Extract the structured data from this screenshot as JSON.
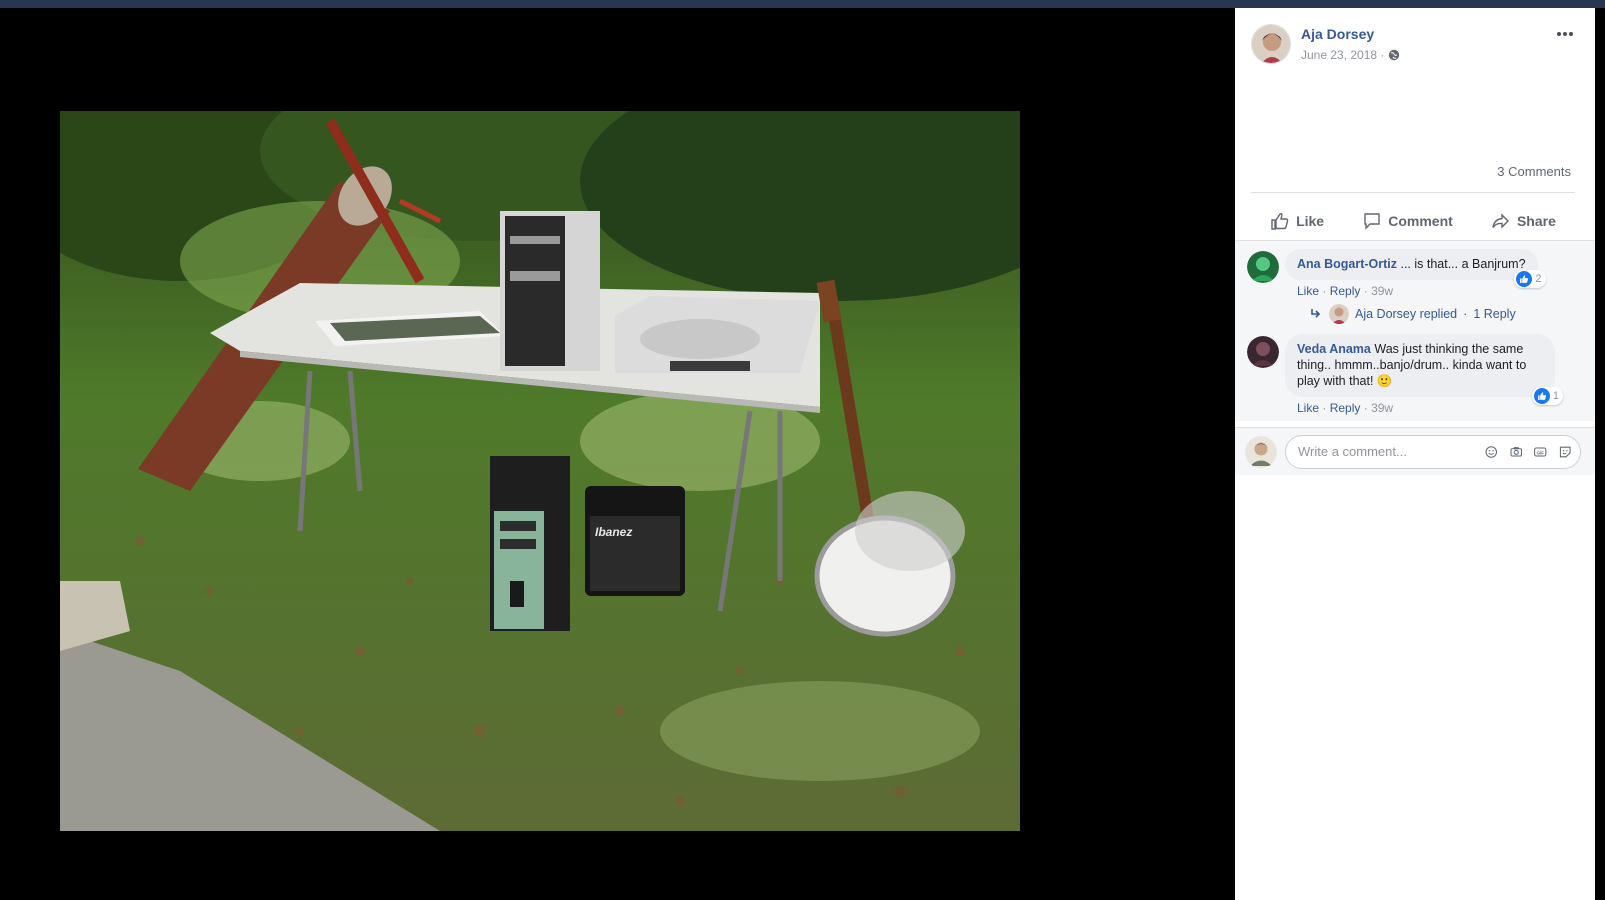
{
  "post": {
    "author": "Aja Dorsey",
    "date": "June 23, 2018 ·",
    "comment_count": "3 Comments"
  },
  "actions": {
    "like": "Like",
    "comment": "Comment",
    "share": "Share"
  },
  "comments": [
    {
      "name": "Ana Bogart-Ortiz",
      "text": " ... is that... a Banjrum?",
      "reaction_count": "2",
      "like": "Like",
      "reply": "Reply",
      "age": "39w",
      "sep": "·",
      "reply_summary": {
        "who": "Aja Dorsey replied",
        "count": "1 Reply",
        "sep": "·"
      }
    },
    {
      "name": "Veda Anama",
      "text": " Was just thinking the same thing.. hmmm..banjo/drum.. kinda want to play with that! 🙂",
      "reaction_count": "1",
      "like": "Like",
      "reply": "Reply",
      "age": "39w",
      "sep": "·"
    }
  ],
  "write": {
    "placeholder": "Write a comment..."
  },
  "icons": {
    "privacy": "globe-icon",
    "more": "ellipsis-icon",
    "like": "thumbs-up-icon",
    "comment": "speech-bubble-icon",
    "share": "share-arrow-icon",
    "emoji": "smiley-icon",
    "camera": "camera-icon",
    "gif": "gif-icon",
    "sticker": "sticker-icon"
  },
  "colors": {
    "link": "#385898",
    "muted": "#90949c",
    "like_blue": "#1877f2",
    "viewer_bg": "#000000"
  }
}
